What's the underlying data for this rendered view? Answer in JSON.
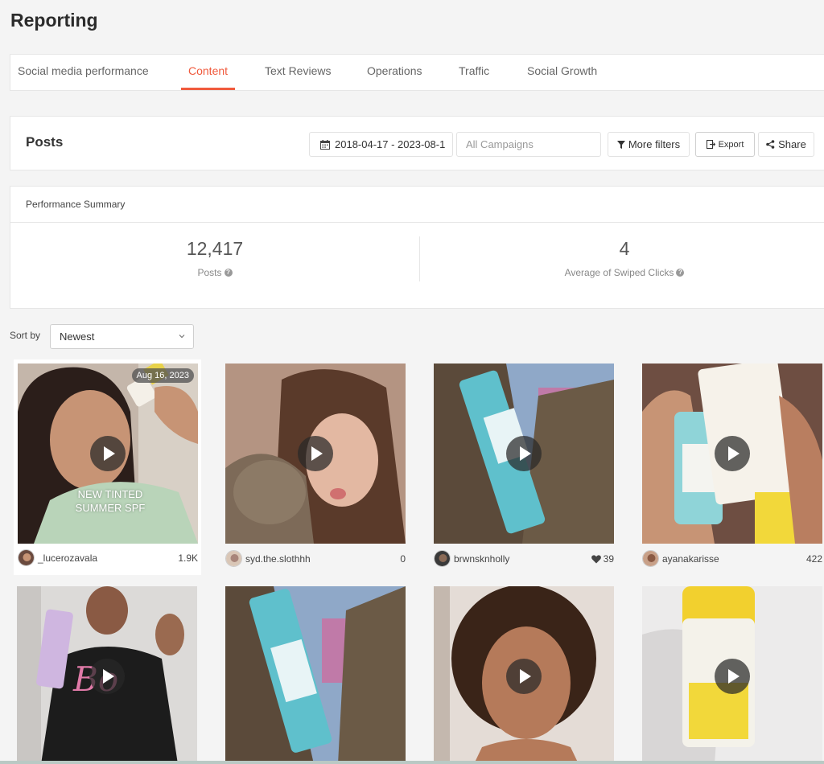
{
  "page": {
    "title": "Reporting"
  },
  "tabs": [
    {
      "label": "Social media performance"
    },
    {
      "label": "Content"
    },
    {
      "label": "Text Reviews"
    },
    {
      "label": "Operations"
    },
    {
      "label": "Traffic"
    },
    {
      "label": "Social Growth"
    }
  ],
  "posts_bar": {
    "title": "Posts",
    "date_range": "2018-04-17 - 2023-08-1",
    "campaign_placeholder": "All Campaigns",
    "more_filters": "More filters",
    "export": "Export",
    "share": "Share"
  },
  "summary": {
    "heading": "Performance Summary",
    "posts_value": "12,417",
    "posts_label": "Posts",
    "clicks_value": "4",
    "clicks_label": "Average of Swiped Clicks"
  },
  "sort": {
    "label": "Sort by",
    "value": "Newest"
  },
  "posts": [
    {
      "username": "_lucerozavala",
      "count": "1.9K",
      "badge": "Aug 16, 2023",
      "overlay_line1": "NEW TINTED",
      "overlay_line2": "SUMMER SPF",
      "icon": "",
      "bg": "#b9a89a"
    },
    {
      "username": "syd.the.slothhh",
      "count": "0",
      "icon": "",
      "bg": "#a88a78"
    },
    {
      "username": "brwnsknholly",
      "count": "39",
      "icon": "heart-icon",
      "bg": "#6e7a5e"
    },
    {
      "username": "ayanakarisse",
      "count": "422",
      "icon": "",
      "bg": "#8a6a5a"
    },
    {
      "username": "",
      "count": "",
      "icon": "",
      "bg": "#d8d6d4"
    },
    {
      "username": "",
      "count": "",
      "icon": "",
      "bg": "#5e6b4e"
    },
    {
      "username": "",
      "count": "",
      "icon": "",
      "bg": "#cfc8c4"
    },
    {
      "username": "",
      "count": "",
      "icon": "",
      "bg": "#e4e4e4"
    }
  ],
  "colors": {
    "accent": "#f05a3d",
    "background": "#f4f4f4"
  }
}
